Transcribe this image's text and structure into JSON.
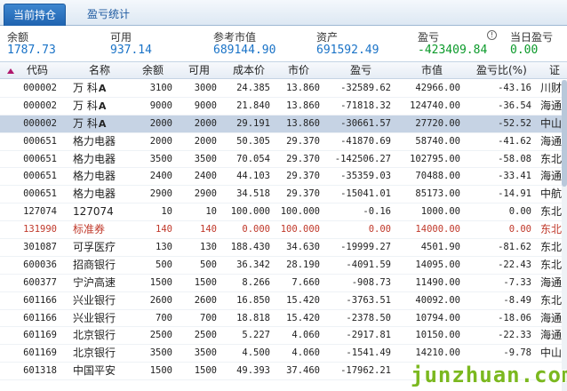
{
  "tabs": [
    {
      "label": "当前持仓",
      "active": true
    },
    {
      "label": "盈亏统计",
      "active": false
    }
  ],
  "summary": [
    {
      "label": "余额",
      "value": "1787.73",
      "color": "#1a73c7"
    },
    {
      "label": "可用",
      "value": "937.14",
      "color": "#1a73c7"
    },
    {
      "label": "参考市值",
      "value": "689144.90",
      "color": "#1a73c7"
    },
    {
      "label": "资产",
      "value": "691592.49",
      "color": "#1a73c7"
    },
    {
      "label": "盈亏",
      "value": "-423409.84",
      "color": "#0b9a2a"
    },
    {
      "label": "当日盈亏",
      "value": "0.00",
      "color": "#0b9a2a"
    }
  ],
  "columns": [
    "代码",
    "名称",
    "余额",
    "可用",
    "成本价",
    "市价",
    "盈亏",
    "市值",
    "盈亏比(%)",
    "证"
  ],
  "rows": [
    {
      "code": "000002",
      "name": "万  科",
      "emblem": "A",
      "balance": "3100",
      "available": "3000",
      "cost": "24.385",
      "price": "13.860",
      "pnl": "-32589.62",
      "value": "42966.00",
      "pnl_pct": "-43.16",
      "market": "川财"
    },
    {
      "code": "000002",
      "name": "万  科",
      "emblem": "A",
      "balance": "9000",
      "available": "9000",
      "cost": "21.840",
      "price": "13.860",
      "pnl": "-71818.32",
      "value": "124740.00",
      "pnl_pct": "-36.54",
      "market": "海通"
    },
    {
      "code": "000002",
      "name": "万  科",
      "emblem": "A",
      "balance": "2000",
      "available": "2000",
      "cost": "29.191",
      "price": "13.860",
      "pnl": "-30661.57",
      "value": "27720.00",
      "pnl_pct": "-52.52",
      "market": "中山",
      "selected": true
    },
    {
      "code": "000651",
      "name": "格力电器",
      "emblem": "",
      "balance": "2000",
      "available": "2000",
      "cost": "50.305",
      "price": "29.370",
      "pnl": "-41870.69",
      "value": "58740.00",
      "pnl_pct": "-41.62",
      "market": "海通"
    },
    {
      "code": "000651",
      "name": "格力电器",
      "emblem": "",
      "balance": "3500",
      "available": "3500",
      "cost": "70.054",
      "price": "29.370",
      "pnl": "-142506.27",
      "value": "102795.00",
      "pnl_pct": "-58.08",
      "market": "东北"
    },
    {
      "code": "000651",
      "name": "格力电器",
      "emblem": "",
      "balance": "2400",
      "available": "2400",
      "cost": "44.103",
      "price": "29.370",
      "pnl": "-35359.03",
      "value": "70488.00",
      "pnl_pct": "-33.41",
      "market": "海通"
    },
    {
      "code": "000651",
      "name": "格力电器",
      "emblem": "",
      "balance": "2900",
      "available": "2900",
      "cost": "34.518",
      "price": "29.370",
      "pnl": "-15041.01",
      "value": "85173.00",
      "pnl_pct": "-14.91",
      "market": "中航"
    },
    {
      "code": "127074",
      "name": "127074",
      "emblem": "",
      "balance": "10",
      "available": "10",
      "cost": "100.000",
      "price": "100.000",
      "pnl": "-0.16",
      "value": "1000.00",
      "pnl_pct": "0.00",
      "market": "东北"
    },
    {
      "code": "131990",
      "name": "标准券",
      "emblem": "",
      "balance": "140",
      "available": "140",
      "cost": "0.000",
      "price": "100.000",
      "pnl": "0.00",
      "value": "14000.00",
      "pnl_pct": "0.00",
      "market": "东北",
      "highlight": true
    },
    {
      "code": "301087",
      "name": "可孚医疗",
      "emblem": "",
      "balance": "130",
      "available": "130",
      "cost": "188.430",
      "price": "34.630",
      "pnl": "-19999.27",
      "value": "4501.90",
      "pnl_pct": "-81.62",
      "market": "东北"
    },
    {
      "code": "600036",
      "name": "招商银行",
      "emblem": "",
      "balance": "500",
      "available": "500",
      "cost": "36.342",
      "price": "28.190",
      "pnl": "-4091.59",
      "value": "14095.00",
      "pnl_pct": "-22.43",
      "market": "东北"
    },
    {
      "code": "600377",
      "name": "宁沪高速",
      "emblem": "",
      "balance": "1500",
      "available": "1500",
      "cost": "8.266",
      "price": "7.660",
      "pnl": "-908.73",
      "value": "11490.00",
      "pnl_pct": "-7.33",
      "market": "海通"
    },
    {
      "code": "601166",
      "name": "兴业银行",
      "emblem": "",
      "balance": "2600",
      "available": "2600",
      "cost": "16.850",
      "price": "15.420",
      "pnl": "-3763.51",
      "value": "40092.00",
      "pnl_pct": "-8.49",
      "market": "东北"
    },
    {
      "code": "601166",
      "name": "兴业银行",
      "emblem": "",
      "balance": "700",
      "available": "700",
      "cost": "18.818",
      "price": "15.420",
      "pnl": "-2378.50",
      "value": "10794.00",
      "pnl_pct": "-18.06",
      "market": "海通"
    },
    {
      "code": "601169",
      "name": "北京银行",
      "emblem": "",
      "balance": "2500",
      "available": "2500",
      "cost": "5.227",
      "price": "4.060",
      "pnl": "-2917.81",
      "value": "10150.00",
      "pnl_pct": "-22.33",
      "market": "海通"
    },
    {
      "code": "601169",
      "name": "北京银行",
      "emblem": "",
      "balance": "3500",
      "available": "3500",
      "cost": "4.500",
      "price": "4.060",
      "pnl": "-1541.49",
      "value": "14210.00",
      "pnl_pct": "-9.78",
      "market": "中山"
    },
    {
      "code": "601318",
      "name": "中国平安",
      "emblem": "",
      "balance": "1500",
      "available": "1500",
      "cost": "49.393",
      "price": "37.460",
      "pnl": "-17962.21",
      "value": "",
      "pnl_pct": "",
      "market": ""
    }
  ],
  "watermark": "junzhuan.com",
  "colors": {
    "accent": "#1f63b0",
    "value_blue": "#1a73c7",
    "loss_green": "#0b9a2a",
    "selected_row": "#c6d3e4",
    "highlight_red": "#c0392b"
  }
}
